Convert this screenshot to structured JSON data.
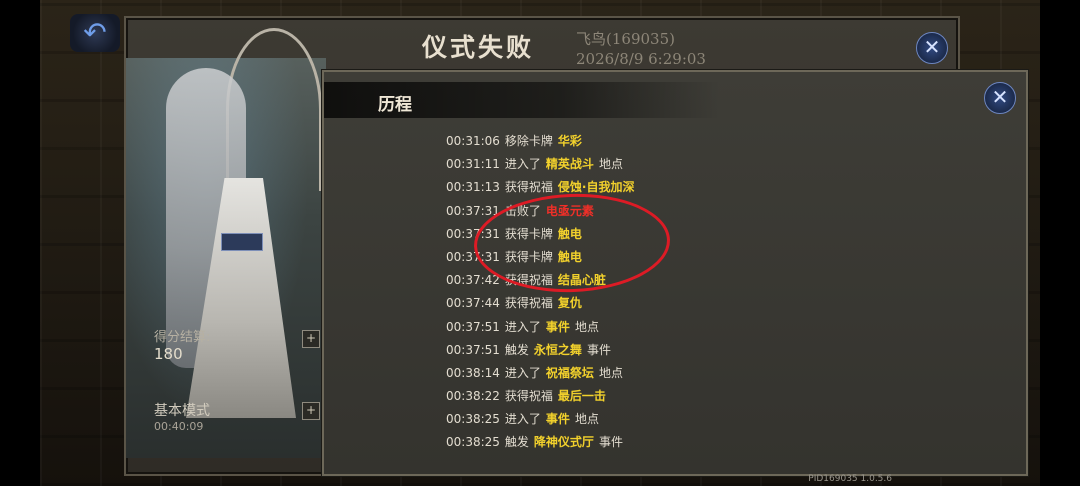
{
  "result": {
    "title": "仪式失败",
    "player_name": "飞鸟(169035)",
    "datetime": "2026/8/9 6:29:03",
    "score_label": "得分结算:",
    "score_value": "180",
    "mode_label": "基本模式",
    "mode_time": "00:40:09"
  },
  "history": {
    "title": "历程",
    "entries": [
      {
        "time": "00:31:06",
        "verb": "移除卡牌",
        "target": "华彩",
        "target_color": "yellow",
        "suffix": ""
      },
      {
        "time": "00:31:11",
        "verb": "进入了",
        "target": "精英战斗",
        "target_color": "yellow",
        "suffix": "地点"
      },
      {
        "time": "00:31:13",
        "verb": "获得祝福",
        "target": "侵蚀·自我加深",
        "target_color": "yellow",
        "suffix": ""
      },
      {
        "time": "00:37:31",
        "verb": "击败了",
        "target": "电亟元素",
        "target_color": "red",
        "suffix": ""
      },
      {
        "time": "00:37:31",
        "verb": "获得卡牌",
        "target": "触电",
        "target_color": "yellow",
        "suffix": ""
      },
      {
        "time": "00:37:31",
        "verb": "获得卡牌",
        "target": "触电",
        "target_color": "yellow",
        "suffix": ""
      },
      {
        "time": "00:37:42",
        "verb": "获得祝福",
        "target": "结晶心脏",
        "target_color": "yellow",
        "suffix": ""
      },
      {
        "time": "00:37:44",
        "verb": "获得祝福",
        "target": "复仇",
        "target_color": "yellow",
        "suffix": ""
      },
      {
        "time": "00:37:51",
        "verb": "进入了",
        "target": "事件",
        "target_color": "yellow",
        "suffix": "地点"
      },
      {
        "time": "00:37:51",
        "verb": "触发",
        "target": "永恒之舞",
        "target_color": "yellow",
        "suffix": "事件"
      },
      {
        "time": "00:38:14",
        "verb": "进入了",
        "target": "祝福祭坛",
        "target_color": "yellow",
        "suffix": "地点"
      },
      {
        "time": "00:38:22",
        "verb": "获得祝福",
        "target": "最后一击",
        "target_color": "yellow",
        "suffix": ""
      },
      {
        "time": "00:38:25",
        "verb": "进入了",
        "target": "事件",
        "target_color": "yellow",
        "suffix": "地点"
      },
      {
        "time": "00:38:25",
        "verb": "触发",
        "target": "降神仪式厅",
        "target_color": "yellow",
        "suffix": "事件"
      }
    ]
  },
  "footer": {
    "version": "PID169035  1.0.5.6"
  },
  "icons": {
    "back": "back-arrow-icon",
    "close": "close-icon",
    "expand": "plus-icon"
  },
  "colors": {
    "highlight_yellow": "#f2d12c",
    "highlight_red": "#ef2f28",
    "annotation_red": "#dd1b25"
  }
}
